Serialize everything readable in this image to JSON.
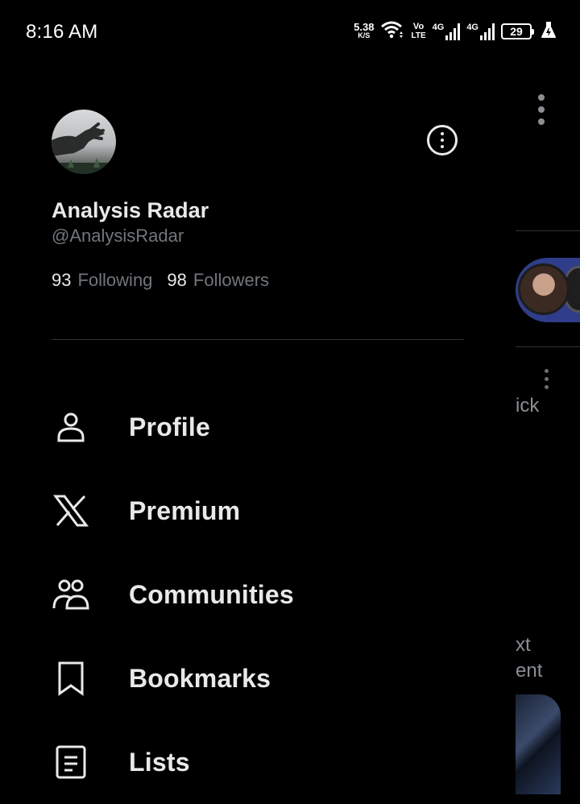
{
  "status_bar": {
    "time": "8:16 AM",
    "net_speed": "5.38",
    "net_speed_unit": "K/S",
    "volte_top": "Vo",
    "volte_bottom": "LTE",
    "sim1_type": "4G",
    "sim2_type": "4G",
    "battery": "29"
  },
  "account": {
    "display_name": "Analysis Radar",
    "handle": "@AnalysisRadar",
    "following_count": "93",
    "following_label": "Following",
    "followers_count": "98",
    "followers_label": "Followers"
  },
  "menu": [
    {
      "label": "Profile",
      "icon": "person-icon"
    },
    {
      "label": "Premium",
      "icon": "x-logo-icon"
    },
    {
      "label": "Communities",
      "icon": "communities-icon"
    },
    {
      "label": "Bookmarks",
      "icon": "bookmark-icon"
    },
    {
      "label": "Lists",
      "icon": "list-icon"
    }
  ],
  "background": {
    "peek_text_1": "ick",
    "peek_text_2": "xt",
    "peek_text_3": "ent"
  }
}
